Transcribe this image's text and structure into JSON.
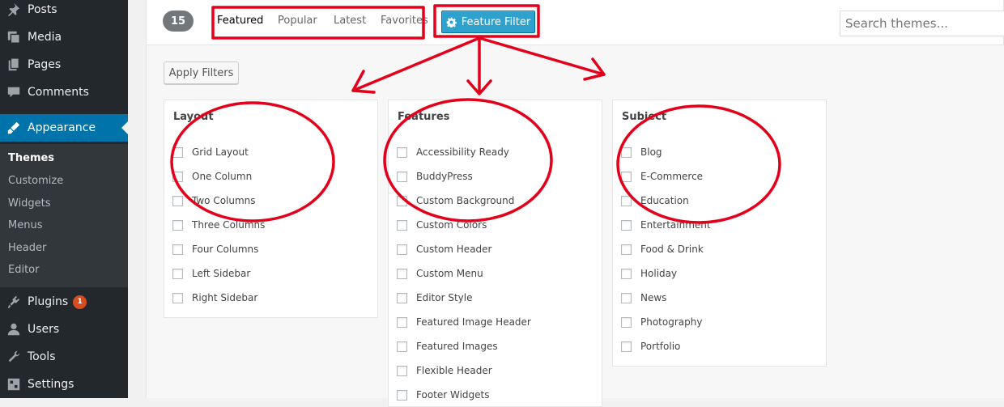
{
  "sidebar": {
    "items": [
      {
        "label": "Posts",
        "icon": "pin-icon"
      },
      {
        "label": "Media",
        "icon": "media-icon"
      },
      {
        "label": "Pages",
        "icon": "pages-icon"
      },
      {
        "label": "Comments",
        "icon": "comments-icon"
      },
      {
        "label": "Appearance",
        "icon": "appearance-icon"
      },
      {
        "label": "Plugins",
        "icon": "plugins-icon",
        "badge": "1"
      },
      {
        "label": "Users",
        "icon": "users-icon"
      },
      {
        "label": "Tools",
        "icon": "tools-icon"
      },
      {
        "label": "Settings",
        "icon": "settings-icon"
      }
    ],
    "submenu": [
      "Themes",
      "Customize",
      "Widgets",
      "Menus",
      "Header",
      "Editor"
    ]
  },
  "filter_bar": {
    "count": "15",
    "tabs": [
      "Featured",
      "Popular",
      "Latest",
      "Favorites"
    ],
    "feature_filter_label": "Feature Filter",
    "search_placeholder": "Search themes..."
  },
  "drawer": {
    "apply_label": "Apply Filters",
    "groups": [
      {
        "title": "Layout",
        "options": [
          "Grid Layout",
          "One Column",
          "Two Columns",
          "Three Columns",
          "Four Columns",
          "Left Sidebar",
          "Right Sidebar"
        ]
      },
      {
        "title": "Features",
        "options": [
          "Accessibility Ready",
          "BuddyPress",
          "Custom Background",
          "Custom Colors",
          "Custom Header",
          "Custom Menu",
          "Editor Style",
          "Featured Image Header",
          "Featured Images",
          "Flexible Header",
          "Footer Widgets"
        ]
      },
      {
        "title": "Subject",
        "options": [
          "Blog",
          "E-Commerce",
          "Education",
          "Entertainment",
          "Food & Drink",
          "Holiday",
          "News",
          "Photography",
          "Portfolio"
        ]
      }
    ]
  },
  "colors": {
    "sidebar_bg": "#23282d",
    "accent": "#0073aa",
    "button_blue": "#2ea2cc",
    "annotation_red": "#e3001b"
  }
}
